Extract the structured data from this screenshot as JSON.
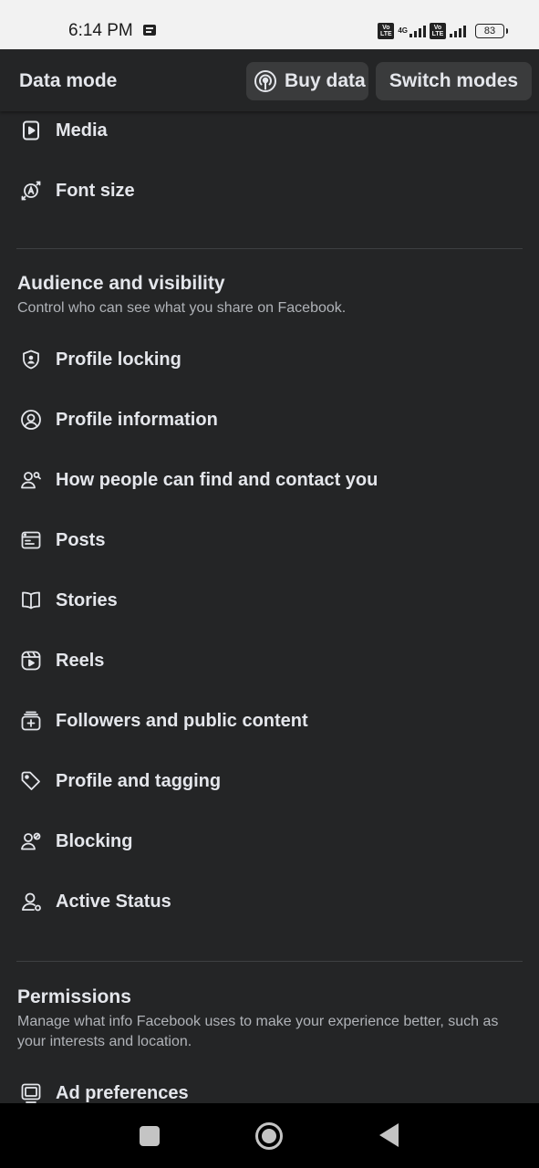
{
  "status_bar": {
    "time": "6:14 PM",
    "network": "4G",
    "volte": "Vo LTE",
    "battery": "83"
  },
  "header": {
    "title": "Data mode",
    "buy_data": "Buy data",
    "switch_modes": "Switch modes"
  },
  "top_items": [
    {
      "label": "Media",
      "icon": "media-play-icon"
    },
    {
      "label": "Font size",
      "icon": "font-size-icon"
    }
  ],
  "audience": {
    "title": "Audience and visibility",
    "description": "Control who can see what you share on Facebook.",
    "items": [
      {
        "label": "Profile locking",
        "icon": "shield-person-icon"
      },
      {
        "label": "Profile information",
        "icon": "person-circle-icon"
      },
      {
        "label": "How people can find and contact you",
        "icon": "person-search-icon"
      },
      {
        "label": "Posts",
        "icon": "posts-icon"
      },
      {
        "label": "Stories",
        "icon": "book-icon"
      },
      {
        "label": "Reels",
        "icon": "reels-icon"
      },
      {
        "label": "Followers and public content",
        "icon": "followers-icon"
      },
      {
        "label": "Profile and tagging",
        "icon": "tag-icon"
      },
      {
        "label": "Blocking",
        "icon": "person-block-icon"
      },
      {
        "label": "Active Status",
        "icon": "person-active-icon"
      }
    ]
  },
  "permissions": {
    "title": "Permissions",
    "description": "Manage what info Facebook uses to make your experience better, such as your interests and location.",
    "items": [
      {
        "label": "Ad preferences",
        "icon": "ad-preferences-icon"
      }
    ]
  }
}
